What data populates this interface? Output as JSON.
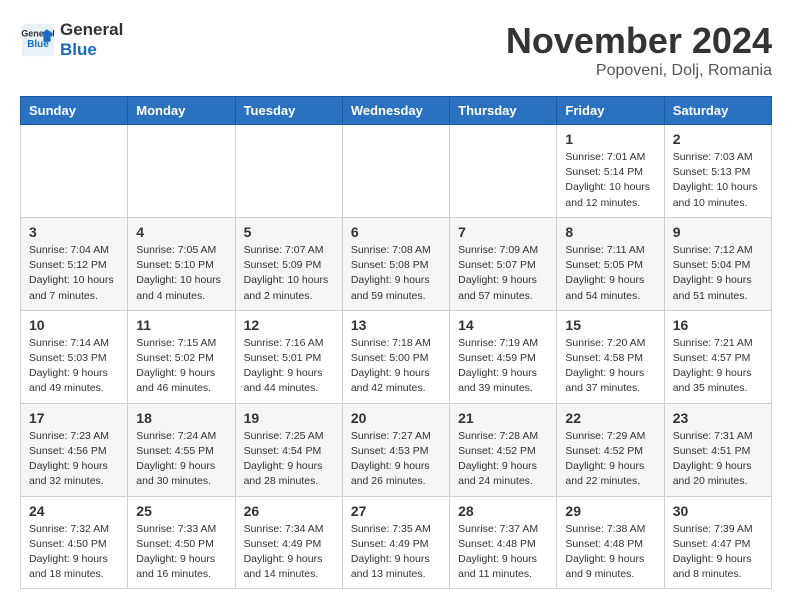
{
  "header": {
    "logo_line1": "General",
    "logo_line2": "Blue",
    "month": "November 2024",
    "location": "Popoveni, Dolj, Romania"
  },
  "weekdays": [
    "Sunday",
    "Monday",
    "Tuesday",
    "Wednesday",
    "Thursday",
    "Friday",
    "Saturday"
  ],
  "weeks": [
    [
      {
        "day": "",
        "info": ""
      },
      {
        "day": "",
        "info": ""
      },
      {
        "day": "",
        "info": ""
      },
      {
        "day": "",
        "info": ""
      },
      {
        "day": "",
        "info": ""
      },
      {
        "day": "1",
        "info": "Sunrise: 7:01 AM\nSunset: 5:14 PM\nDaylight: 10 hours and 12 minutes."
      },
      {
        "day": "2",
        "info": "Sunrise: 7:03 AM\nSunset: 5:13 PM\nDaylight: 10 hours and 10 minutes."
      }
    ],
    [
      {
        "day": "3",
        "info": "Sunrise: 7:04 AM\nSunset: 5:12 PM\nDaylight: 10 hours and 7 minutes."
      },
      {
        "day": "4",
        "info": "Sunrise: 7:05 AM\nSunset: 5:10 PM\nDaylight: 10 hours and 4 minutes."
      },
      {
        "day": "5",
        "info": "Sunrise: 7:07 AM\nSunset: 5:09 PM\nDaylight: 10 hours and 2 minutes."
      },
      {
        "day": "6",
        "info": "Sunrise: 7:08 AM\nSunset: 5:08 PM\nDaylight: 9 hours and 59 minutes."
      },
      {
        "day": "7",
        "info": "Sunrise: 7:09 AM\nSunset: 5:07 PM\nDaylight: 9 hours and 57 minutes."
      },
      {
        "day": "8",
        "info": "Sunrise: 7:11 AM\nSunset: 5:05 PM\nDaylight: 9 hours and 54 minutes."
      },
      {
        "day": "9",
        "info": "Sunrise: 7:12 AM\nSunset: 5:04 PM\nDaylight: 9 hours and 51 minutes."
      }
    ],
    [
      {
        "day": "10",
        "info": "Sunrise: 7:14 AM\nSunset: 5:03 PM\nDaylight: 9 hours and 49 minutes."
      },
      {
        "day": "11",
        "info": "Sunrise: 7:15 AM\nSunset: 5:02 PM\nDaylight: 9 hours and 46 minutes."
      },
      {
        "day": "12",
        "info": "Sunrise: 7:16 AM\nSunset: 5:01 PM\nDaylight: 9 hours and 44 minutes."
      },
      {
        "day": "13",
        "info": "Sunrise: 7:18 AM\nSunset: 5:00 PM\nDaylight: 9 hours and 42 minutes."
      },
      {
        "day": "14",
        "info": "Sunrise: 7:19 AM\nSunset: 4:59 PM\nDaylight: 9 hours and 39 minutes."
      },
      {
        "day": "15",
        "info": "Sunrise: 7:20 AM\nSunset: 4:58 PM\nDaylight: 9 hours and 37 minutes."
      },
      {
        "day": "16",
        "info": "Sunrise: 7:21 AM\nSunset: 4:57 PM\nDaylight: 9 hours and 35 minutes."
      }
    ],
    [
      {
        "day": "17",
        "info": "Sunrise: 7:23 AM\nSunset: 4:56 PM\nDaylight: 9 hours and 32 minutes."
      },
      {
        "day": "18",
        "info": "Sunrise: 7:24 AM\nSunset: 4:55 PM\nDaylight: 9 hours and 30 minutes."
      },
      {
        "day": "19",
        "info": "Sunrise: 7:25 AM\nSunset: 4:54 PM\nDaylight: 9 hours and 28 minutes."
      },
      {
        "day": "20",
        "info": "Sunrise: 7:27 AM\nSunset: 4:53 PM\nDaylight: 9 hours and 26 minutes."
      },
      {
        "day": "21",
        "info": "Sunrise: 7:28 AM\nSunset: 4:52 PM\nDaylight: 9 hours and 24 minutes."
      },
      {
        "day": "22",
        "info": "Sunrise: 7:29 AM\nSunset: 4:52 PM\nDaylight: 9 hours and 22 minutes."
      },
      {
        "day": "23",
        "info": "Sunrise: 7:31 AM\nSunset: 4:51 PM\nDaylight: 9 hours and 20 minutes."
      }
    ],
    [
      {
        "day": "24",
        "info": "Sunrise: 7:32 AM\nSunset: 4:50 PM\nDaylight: 9 hours and 18 minutes."
      },
      {
        "day": "25",
        "info": "Sunrise: 7:33 AM\nSunset: 4:50 PM\nDaylight: 9 hours and 16 minutes."
      },
      {
        "day": "26",
        "info": "Sunrise: 7:34 AM\nSunset: 4:49 PM\nDaylight: 9 hours and 14 minutes."
      },
      {
        "day": "27",
        "info": "Sunrise: 7:35 AM\nSunset: 4:49 PM\nDaylight: 9 hours and 13 minutes."
      },
      {
        "day": "28",
        "info": "Sunrise: 7:37 AM\nSunset: 4:48 PM\nDaylight: 9 hours and 11 minutes."
      },
      {
        "day": "29",
        "info": "Sunrise: 7:38 AM\nSunset: 4:48 PM\nDaylight: 9 hours and 9 minutes."
      },
      {
        "day": "30",
        "info": "Sunrise: 7:39 AM\nSunset: 4:47 PM\nDaylight: 9 hours and 8 minutes."
      }
    ]
  ]
}
